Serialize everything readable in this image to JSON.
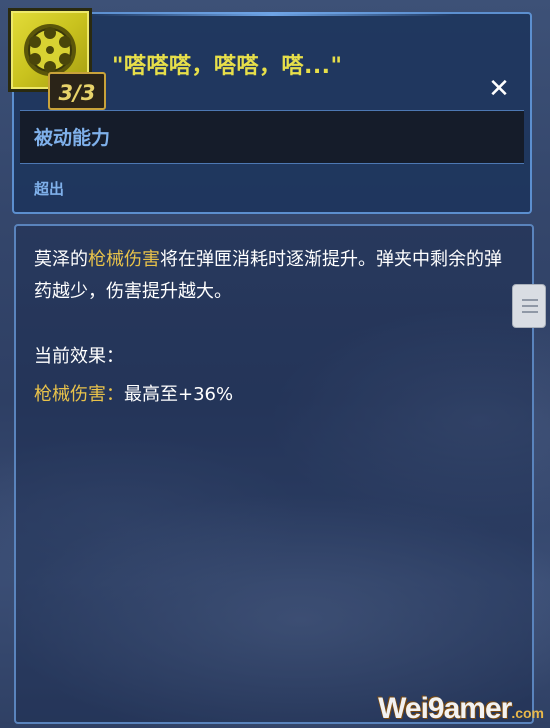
{
  "skill": {
    "icon": "revolver-cylinder-icon",
    "charges": "3/3",
    "quote": "\"嗒嗒嗒，嗒嗒，嗒...\"",
    "ability_type": "被动能力",
    "tag": "超出"
  },
  "description": {
    "prefix": "莫泽的",
    "highlight": "枪械伤害",
    "suffix": "将在弹匣消耗时逐渐提升。弹夹中剩余的弹药越少，伤害提升越大。"
  },
  "effects": {
    "heading": "当前效果：",
    "stat_label": "枪械伤害：",
    "stat_value": "最高至+36%"
  },
  "watermark": {
    "text": "Wei9amer",
    "sub": ".com"
  },
  "colors": {
    "title_yellow": "#e7df4a",
    "highlight_gold": "#e8c24a",
    "label_blue": "#7fb0ea",
    "border_blue": "#5c8fcf"
  }
}
